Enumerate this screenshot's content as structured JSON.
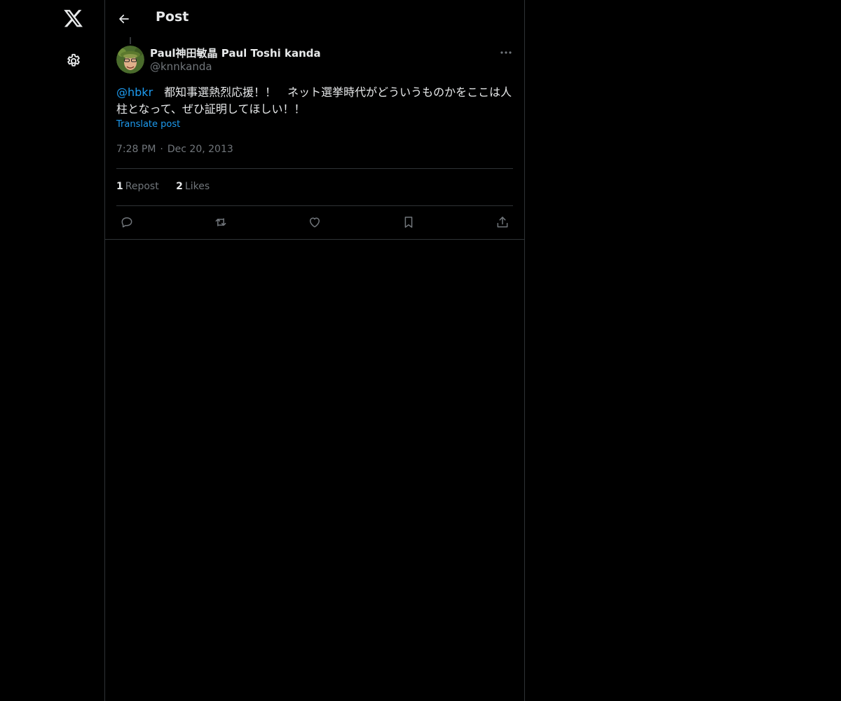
{
  "header": {
    "title": "Post",
    "back_icon": "arrow-left-icon"
  },
  "nav": {
    "logo_icon": "x-logo-icon",
    "settings_icon": "gear-icon"
  },
  "post": {
    "author_name": "Paul神田敏晶 Paul Toshi kanda",
    "author_handle": "@knnkanda",
    "mention": "@hbkr",
    "text": "　都知事選熱烈応援！！　ネット選挙時代がどういうものかをここは人柱となって、ぜひ証明してほしい！！",
    "translate_label": "Translate post",
    "time": "7:28 PM",
    "separator": "·",
    "date": "Dec 20, 2013",
    "reposts_count": "1",
    "reposts_label": "Repost",
    "likes_count": "2",
    "likes_label": "Likes"
  },
  "actions": {
    "reply_icon": "reply-icon",
    "repost_icon": "repost-icon",
    "like_icon": "heart-icon",
    "bookmark_icon": "bookmark-icon",
    "share_icon": "share-icon"
  },
  "colors": {
    "background": "#000000",
    "text_primary": "#e7e9ea",
    "text_secondary": "#71767b",
    "accent": "#1d9bf0",
    "border": "#2f3336"
  }
}
